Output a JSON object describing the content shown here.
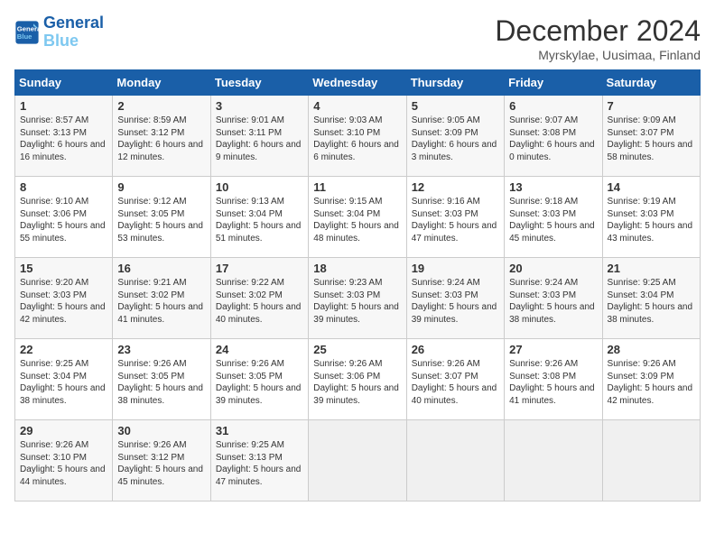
{
  "header": {
    "logo_line1": "General",
    "logo_line2": "Blue",
    "month": "December 2024",
    "location": "Myrskylae, Uusimaa, Finland"
  },
  "days_of_week": [
    "Sunday",
    "Monday",
    "Tuesday",
    "Wednesday",
    "Thursday",
    "Friday",
    "Saturday"
  ],
  "weeks": [
    [
      {
        "day": "1",
        "sunrise": "Sunrise: 8:57 AM",
        "sunset": "Sunset: 3:13 PM",
        "daylight": "Daylight: 6 hours and 16 minutes."
      },
      {
        "day": "2",
        "sunrise": "Sunrise: 8:59 AM",
        "sunset": "Sunset: 3:12 PM",
        "daylight": "Daylight: 6 hours and 12 minutes."
      },
      {
        "day": "3",
        "sunrise": "Sunrise: 9:01 AM",
        "sunset": "Sunset: 3:11 PM",
        "daylight": "Daylight: 6 hours and 9 minutes."
      },
      {
        "day": "4",
        "sunrise": "Sunrise: 9:03 AM",
        "sunset": "Sunset: 3:10 PM",
        "daylight": "Daylight: 6 hours and 6 minutes."
      },
      {
        "day": "5",
        "sunrise": "Sunrise: 9:05 AM",
        "sunset": "Sunset: 3:09 PM",
        "daylight": "Daylight: 6 hours and 3 minutes."
      },
      {
        "day": "6",
        "sunrise": "Sunrise: 9:07 AM",
        "sunset": "Sunset: 3:08 PM",
        "daylight": "Daylight: 6 hours and 0 minutes."
      },
      {
        "day": "7",
        "sunrise": "Sunrise: 9:09 AM",
        "sunset": "Sunset: 3:07 PM",
        "daylight": "Daylight: 5 hours and 58 minutes."
      }
    ],
    [
      {
        "day": "8",
        "sunrise": "Sunrise: 9:10 AM",
        "sunset": "Sunset: 3:06 PM",
        "daylight": "Daylight: 5 hours and 55 minutes."
      },
      {
        "day": "9",
        "sunrise": "Sunrise: 9:12 AM",
        "sunset": "Sunset: 3:05 PM",
        "daylight": "Daylight: 5 hours and 53 minutes."
      },
      {
        "day": "10",
        "sunrise": "Sunrise: 9:13 AM",
        "sunset": "Sunset: 3:04 PM",
        "daylight": "Daylight: 5 hours and 51 minutes."
      },
      {
        "day": "11",
        "sunrise": "Sunrise: 9:15 AM",
        "sunset": "Sunset: 3:04 PM",
        "daylight": "Daylight: 5 hours and 48 minutes."
      },
      {
        "day": "12",
        "sunrise": "Sunrise: 9:16 AM",
        "sunset": "Sunset: 3:03 PM",
        "daylight": "Daylight: 5 hours and 47 minutes."
      },
      {
        "day": "13",
        "sunrise": "Sunrise: 9:18 AM",
        "sunset": "Sunset: 3:03 PM",
        "daylight": "Daylight: 5 hours and 45 minutes."
      },
      {
        "day": "14",
        "sunrise": "Sunrise: 9:19 AM",
        "sunset": "Sunset: 3:03 PM",
        "daylight": "Daylight: 5 hours and 43 minutes."
      }
    ],
    [
      {
        "day": "15",
        "sunrise": "Sunrise: 9:20 AM",
        "sunset": "Sunset: 3:03 PM",
        "daylight": "Daylight: 5 hours and 42 minutes."
      },
      {
        "day": "16",
        "sunrise": "Sunrise: 9:21 AM",
        "sunset": "Sunset: 3:02 PM",
        "daylight": "Daylight: 5 hours and 41 minutes."
      },
      {
        "day": "17",
        "sunrise": "Sunrise: 9:22 AM",
        "sunset": "Sunset: 3:02 PM",
        "daylight": "Daylight: 5 hours and 40 minutes."
      },
      {
        "day": "18",
        "sunrise": "Sunrise: 9:23 AM",
        "sunset": "Sunset: 3:03 PM",
        "daylight": "Daylight: 5 hours and 39 minutes."
      },
      {
        "day": "19",
        "sunrise": "Sunrise: 9:24 AM",
        "sunset": "Sunset: 3:03 PM",
        "daylight": "Daylight: 5 hours and 39 minutes."
      },
      {
        "day": "20",
        "sunrise": "Sunrise: 9:24 AM",
        "sunset": "Sunset: 3:03 PM",
        "daylight": "Daylight: 5 hours and 38 minutes."
      },
      {
        "day": "21",
        "sunrise": "Sunrise: 9:25 AM",
        "sunset": "Sunset: 3:04 PM",
        "daylight": "Daylight: 5 hours and 38 minutes."
      }
    ],
    [
      {
        "day": "22",
        "sunrise": "Sunrise: 9:25 AM",
        "sunset": "Sunset: 3:04 PM",
        "daylight": "Daylight: 5 hours and 38 minutes."
      },
      {
        "day": "23",
        "sunrise": "Sunrise: 9:26 AM",
        "sunset": "Sunset: 3:05 PM",
        "daylight": "Daylight: 5 hours and 38 minutes."
      },
      {
        "day": "24",
        "sunrise": "Sunrise: 9:26 AM",
        "sunset": "Sunset: 3:05 PM",
        "daylight": "Daylight: 5 hours and 39 minutes."
      },
      {
        "day": "25",
        "sunrise": "Sunrise: 9:26 AM",
        "sunset": "Sunset: 3:06 PM",
        "daylight": "Daylight: 5 hours and 39 minutes."
      },
      {
        "day": "26",
        "sunrise": "Sunrise: 9:26 AM",
        "sunset": "Sunset: 3:07 PM",
        "daylight": "Daylight: 5 hours and 40 minutes."
      },
      {
        "day": "27",
        "sunrise": "Sunrise: 9:26 AM",
        "sunset": "Sunset: 3:08 PM",
        "daylight": "Daylight: 5 hours and 41 minutes."
      },
      {
        "day": "28",
        "sunrise": "Sunrise: 9:26 AM",
        "sunset": "Sunset: 3:09 PM",
        "daylight": "Daylight: 5 hours and 42 minutes."
      }
    ],
    [
      {
        "day": "29",
        "sunrise": "Sunrise: 9:26 AM",
        "sunset": "Sunset: 3:10 PM",
        "daylight": "Daylight: 5 hours and 44 minutes."
      },
      {
        "day": "30",
        "sunrise": "Sunrise: 9:26 AM",
        "sunset": "Sunset: 3:12 PM",
        "daylight": "Daylight: 5 hours and 45 minutes."
      },
      {
        "day": "31",
        "sunrise": "Sunrise: 9:25 AM",
        "sunset": "Sunset: 3:13 PM",
        "daylight": "Daylight: 5 hours and 47 minutes."
      },
      null,
      null,
      null,
      null
    ]
  ]
}
